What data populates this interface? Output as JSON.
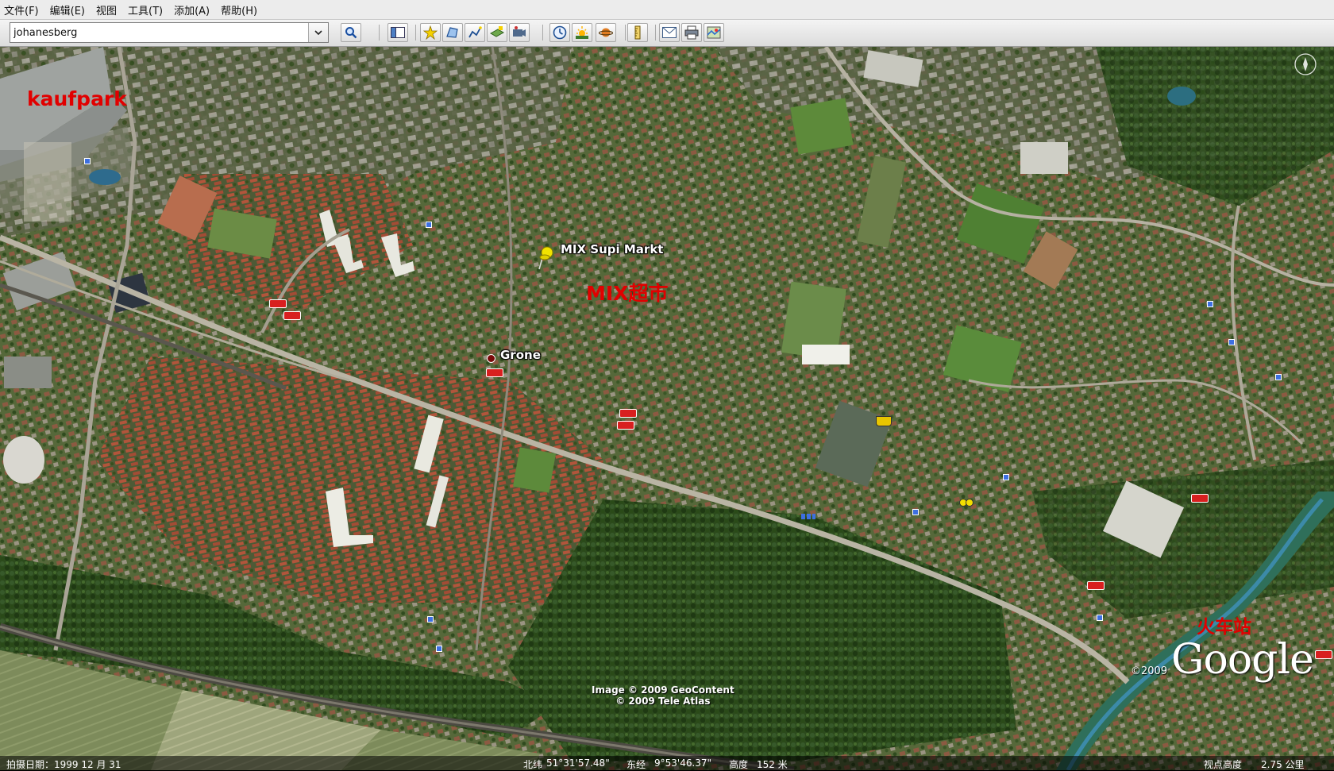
{
  "menu": [
    {
      "label": "文件(F)"
    },
    {
      "label": "编辑(E)"
    },
    {
      "label": "视图"
    },
    {
      "label": "工具(T)"
    },
    {
      "label": "添加(A)"
    },
    {
      "label": "帮助(H)"
    }
  ],
  "search": {
    "value": "johanesberg"
  },
  "toolbar_icons": [
    "search-icon",
    "sidebar-icon",
    "placemark-icon",
    "polygon-icon",
    "path-icon",
    "image-overlay-icon",
    "record-tour-icon",
    "historical-imagery-icon",
    "sunlight-icon",
    "planets-icon",
    "ruler-icon",
    "email-icon",
    "print-icon",
    "view-in-maps-icon"
  ],
  "map": {
    "places": {
      "mix_supi_markt": "MIX Supi Markt",
      "grone": "Grone"
    },
    "annotations": {
      "kaufpark": "kaufpark",
      "mix_chinese": "MIX超市",
      "station": "火车站"
    },
    "copyright": {
      "line1": "Image © 2009 GeoContent",
      "line2": "© 2009 Tele Atlas"
    },
    "google": {
      "copy": "©2009",
      "logo": "Google"
    }
  },
  "status": {
    "date_label": "拍摄日期：1999 12 月 31",
    "lat_label": "北纬",
    "lat": "51°31'57.48\"",
    "lon_label": "东经",
    "lon": "9°53'46.37\"",
    "alt_label": "高度",
    "alt": "152 米",
    "eye_label": "视点高度",
    "eye": "2.75 公里"
  },
  "colors": {
    "annotation_red": "#e10000",
    "pin_yellow": "#f2e300"
  }
}
